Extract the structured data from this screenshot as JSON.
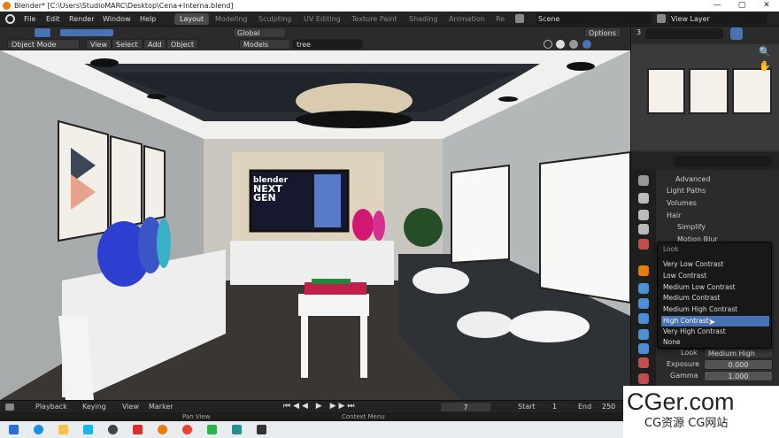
{
  "titlebar": {
    "title": "Blender* [C:\\Users\\StudioMARC\\Desktop\\Cena+Interna.blend]",
    "min": "—",
    "max": "▢",
    "close": "✕"
  },
  "menu": {
    "file": "File",
    "edit": "Edit",
    "render": "Render",
    "window": "Window",
    "help": "Help"
  },
  "workspaces": [
    "Layout",
    "Modeling",
    "Sculpting",
    "UV Editing",
    "Texture Paint",
    "Shading",
    "Animation",
    "Re"
  ],
  "scene": {
    "label": "Scene"
  },
  "view_layer": {
    "label": "View Layer"
  },
  "viewport_header": {
    "mode": "Object Mode",
    "view": "View",
    "select": "Select",
    "add": "Add",
    "object": "Object",
    "orientation": "Global",
    "models": "Models",
    "search_value": "tree",
    "options": "Options"
  },
  "outliner": {
    "count": "3"
  },
  "properties": {
    "search_placeholder": "",
    "rows": [
      "Advanced",
      "Light Paths",
      "Volumes",
      "Hair",
      "Simplify",
      "Motion Blur"
    ],
    "look_label": "Look",
    "look_value": "Medium High C...",
    "exposure_label": "Exposure",
    "exposure_value": "0.000",
    "gamma_label": "Gamma",
    "gamma_value": "1.000"
  },
  "look_dropdown": {
    "title": "Look",
    "items": [
      "Very Low Contrast",
      "Low Contrast",
      "Medium Low Contrast",
      "Medium Contrast",
      "Medium High Contrast",
      "High Contrast",
      "Very High Contrast",
      "None"
    ],
    "selected": "High Contrast"
  },
  "timeline": {
    "playback": "Playback",
    "keying": "Keying",
    "view": "View",
    "marker": "Marker",
    "frame": "7",
    "start_label": "Start",
    "start": "1",
    "end_label": "End",
    "end": "250"
  },
  "status": {
    "pan": "Pan View",
    "context": "Context Menu"
  },
  "tv": {
    "line1": "blender",
    "line2": "NEXT",
    "line3": "GEN"
  },
  "watermark": {
    "big": "CGer.com",
    "small": "CG资源  CG网站"
  },
  "colors": {
    "accent": "#4772b3",
    "blender_orange": "#e87d0d"
  }
}
